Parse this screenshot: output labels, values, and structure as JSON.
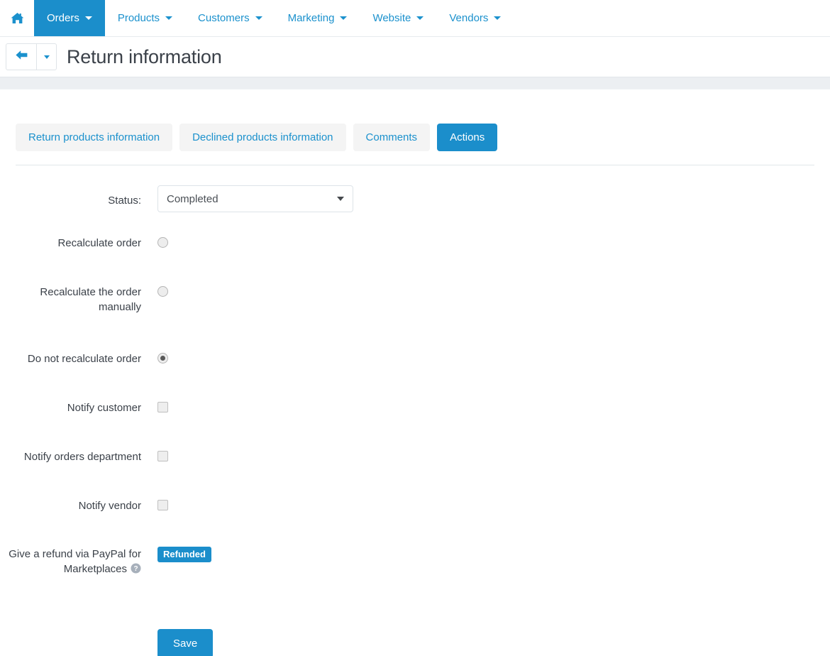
{
  "nav": {
    "home_icon": "home-icon",
    "items": [
      {
        "label": "Orders",
        "active": true,
        "has_caret": true
      },
      {
        "label": "Products",
        "active": false,
        "has_caret": true
      },
      {
        "label": "Customers",
        "active": false,
        "has_caret": true
      },
      {
        "label": "Marketing",
        "active": false,
        "has_caret": true
      },
      {
        "label": "Website",
        "active": false,
        "has_caret": true
      },
      {
        "label": "Vendors",
        "active": false,
        "has_caret": true
      }
    ]
  },
  "header": {
    "back_icon": "arrow-left-icon",
    "back_dropdown_icon": "chevron-down-icon",
    "title": "Return information"
  },
  "tabs": [
    {
      "label": "Return products information",
      "active": false
    },
    {
      "label": "Declined products information",
      "active": false
    },
    {
      "label": "Comments",
      "active": false
    },
    {
      "label": "Actions",
      "active": true
    }
  ],
  "form": {
    "status": {
      "label": "Status:",
      "value": "Completed",
      "caret_icon": "chevron-down-icon"
    },
    "options": [
      {
        "label": "Recalculate order",
        "type": "radio",
        "checked": false
      },
      {
        "label": "Recalculate the order manually",
        "type": "radio",
        "checked": false
      },
      {
        "label": "Do not recalculate order",
        "type": "radio",
        "checked": true
      },
      {
        "label": "Notify customer",
        "type": "checkbox",
        "checked": false
      },
      {
        "label": "Notify orders department",
        "type": "checkbox",
        "checked": false
      },
      {
        "label": "Notify vendor",
        "type": "checkbox",
        "checked": false
      }
    ],
    "refund": {
      "label": "Give a refund via PayPal for Marketplaces",
      "help_icon": "help-circle-icon",
      "badge": "Refunded"
    },
    "save_label": "Save"
  },
  "colors": {
    "accent": "#1b8ecb",
    "link": "#1b91cd",
    "band": "#eceff2",
    "tab_inactive_bg": "#f4f4f4",
    "text": "#3b4149"
  }
}
